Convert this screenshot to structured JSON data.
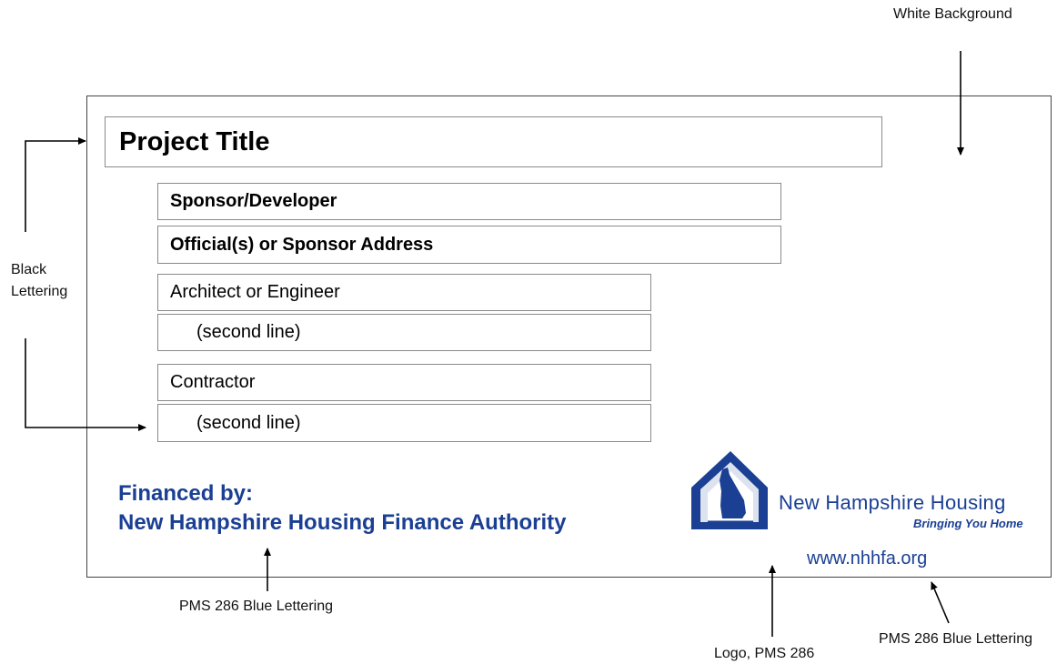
{
  "annotations": {
    "white_background": "White Background",
    "black_lettering_line1": "Black",
    "black_lettering_line2": "Lettering",
    "pms_blue_left": "PMS 286 Blue Lettering",
    "logo_pms": "Logo, PMS 286",
    "pms_blue_right": "PMS 286 Blue Lettering"
  },
  "sign": {
    "project_title": "Project Title",
    "sponsor_developer": "Sponsor/Developer",
    "sponsor_address": "Official(s) or Sponsor Address",
    "architect": "Architect or Engineer",
    "architect_second": "(second line)",
    "contractor": "Contractor",
    "contractor_second": "(second line)",
    "financed_by": "Financed by:",
    "financed_org": "New Hampshire Housing Finance Authority",
    "logo_name": "New Hampshire Housing",
    "logo_tagline": "Bringing You Home",
    "website": "www.nhhfa.org"
  },
  "colors": {
    "pms_286_blue": "#1a3f93",
    "lettering": "#000000",
    "background": "#ffffff"
  },
  "icons": {
    "logo": "new-hampshire-house-logo-icon"
  }
}
